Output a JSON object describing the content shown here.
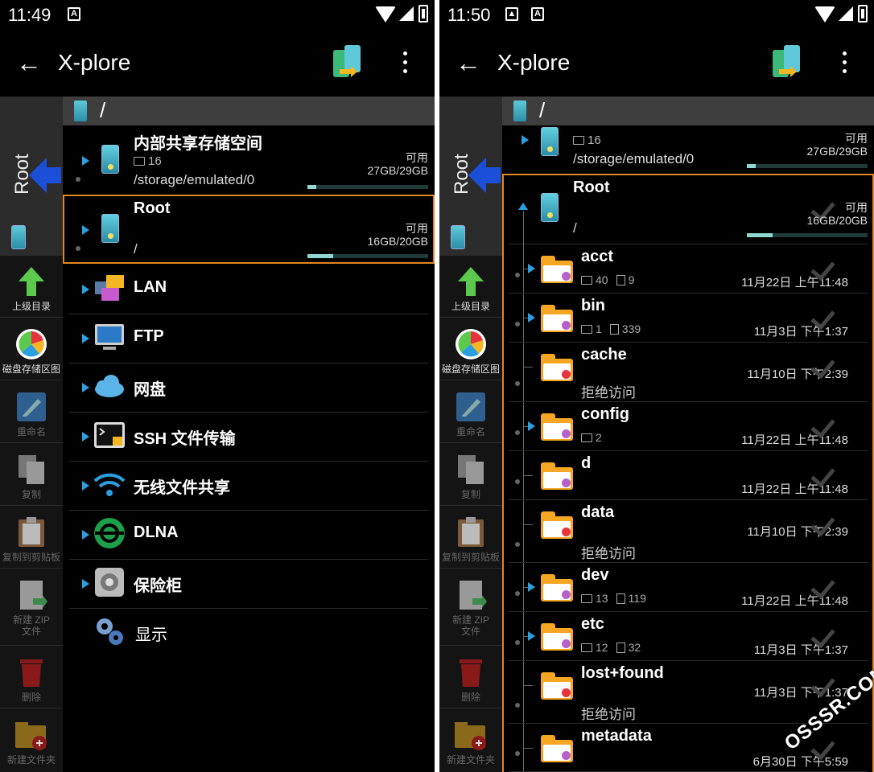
{
  "left": {
    "time": "11:49",
    "title": "X-plore",
    "path": "/",
    "storage": {
      "name": "内部共享存储空间",
      "count": "16",
      "path": "/storage/emulated/0",
      "free_label": "可用",
      "free": "27GB/29GB",
      "fill": 0.07
    },
    "root": {
      "name": "Root",
      "path": "/",
      "free_label": "可用",
      "free": "16GB/20GB",
      "fill": 0.21
    },
    "menu": [
      {
        "label": "LAN",
        "icon": "lan-icon"
      },
      {
        "label": "FTP",
        "icon": "ftp-icon"
      },
      {
        "label": "网盘",
        "icon": "cloud-icon"
      },
      {
        "label": "SSH 文件传输",
        "icon": "ssh-icon"
      },
      {
        "label": "无线文件共享",
        "icon": "wifi-share-icon"
      },
      {
        "label": "DLNA",
        "icon": "dlna-icon"
      },
      {
        "label": "保险柜",
        "icon": "vault-icon"
      }
    ],
    "display": "显示"
  },
  "right": {
    "time": "11:50",
    "title": "X-plore",
    "path": "/",
    "storage": {
      "count": "16",
      "path": "/storage/emulated/0",
      "free_label": "可用",
      "free": "27GB/29GB",
      "fill": 0.07
    },
    "root": {
      "name": "Root",
      "path": "/",
      "free_label": "可用",
      "free": "16GB/20GB",
      "fill": 0.21
    },
    "folders": [
      {
        "name": "acct",
        "dirs": "40",
        "files": "9",
        "date": "11月22日 上午11:48",
        "color": "#b561c9"
      },
      {
        "name": "bin",
        "dirs": "1",
        "files": "339",
        "date": "11月3日 下午1:37",
        "color": "#b561c9"
      },
      {
        "name": "cache",
        "denied": "拒绝访问",
        "date": "11月10日 下午2:39",
        "color": "#e8323c"
      },
      {
        "name": "config",
        "dirs": "2",
        "date": "11月22日 上午11:48",
        "color": "#b561c9"
      },
      {
        "name": "d",
        "date": "11月22日 上午11:48",
        "color": "#b561c9"
      },
      {
        "name": "data",
        "denied": "拒绝访问",
        "date": "11月10日 下午2:39",
        "color": "#e8323c"
      },
      {
        "name": "dev",
        "dirs": "13",
        "files": "119",
        "date": "11月22日 上午11:48",
        "color": "#b561c9"
      },
      {
        "name": "etc",
        "dirs": "12",
        "files": "32",
        "date": "11月3日 下午1:37",
        "color": "#b561c9"
      },
      {
        "name": "lost+found",
        "denied": "拒绝访问",
        "date": "11月3日 下午1:37",
        "color": "#e8323c"
      },
      {
        "name": "metadata",
        "date": "6月30日 下午5:59",
        "color": "#b561c9"
      }
    ]
  },
  "sidebar": {
    "root_label": "Root",
    "buttons": [
      {
        "label": "上级目录",
        "icon": "up-arrow-icon",
        "enabled": true
      },
      {
        "label": "磁盘存储区图",
        "icon": "disk-map-icon",
        "enabled": true
      },
      {
        "label": "重命名",
        "icon": "rename-icon",
        "enabled": false
      },
      {
        "label": "复制",
        "icon": "copy-icon",
        "enabled": false
      },
      {
        "label": "复制到剪贴板",
        "icon": "clipboard-icon",
        "enabled": false
      },
      {
        "label": "新建 ZIP 文件",
        "icon": "zip-icon",
        "enabled": false
      },
      {
        "label": "删除",
        "icon": "trash-icon",
        "enabled": false
      },
      {
        "label": "新建文件夹",
        "icon": "new-folder-icon",
        "enabled": false
      }
    ]
  },
  "watermark": "OSSSR.COM"
}
